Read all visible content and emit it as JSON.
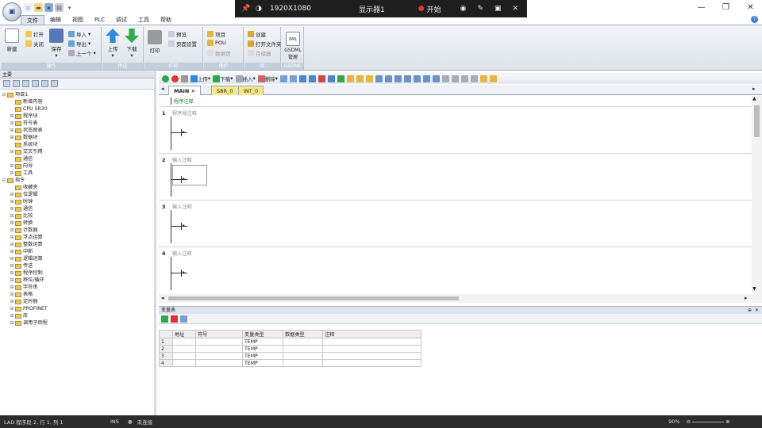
{
  "overlay": {
    "resolution": "1920X1080",
    "display": "显示器1",
    "record": "开始"
  },
  "menu": [
    "文件",
    "编辑",
    "视图",
    "PLC",
    "调试",
    "工具",
    "帮助"
  ],
  "ribbon": {
    "groups": [
      "操作",
      "传送",
      "打印",
      "保护",
      "库",
      "GSDML"
    ],
    "new": "新建",
    "open": "打开",
    "close": "关闭",
    "save": "保存",
    "import": "导入",
    "export": "导出",
    "prev": "上一个",
    "upload": "上传",
    "download": "下载",
    "print": "打印",
    "preview": "预览",
    "page_setup": "页面设置",
    "project": "项目",
    "pou": "POU",
    "data_page": "数据页",
    "create": "创建",
    "open_folder": "打开文件夹",
    "memory": "存储器",
    "gsdml": "GSDML管理"
  },
  "left_panel": {
    "title": "主要",
    "tree": [
      {
        "label": "项目1",
        "level": 0,
        "exp": "⊟"
      },
      {
        "label": "新增内容",
        "level": 1,
        "exp": ""
      },
      {
        "label": "CPU SR30",
        "level": 1,
        "exp": ""
      },
      {
        "label": "程序块",
        "level": 1,
        "exp": "⊞"
      },
      {
        "label": "符号表",
        "level": 1,
        "exp": "⊞"
      },
      {
        "label": "状态图表",
        "level": 1,
        "exp": "⊞"
      },
      {
        "label": "数据块",
        "level": 1,
        "exp": "⊞"
      },
      {
        "label": "系统块",
        "level": 1,
        "exp": ""
      },
      {
        "label": "交叉引用",
        "level": 1,
        "exp": "⊞"
      },
      {
        "label": "通信",
        "level": 1,
        "exp": ""
      },
      {
        "label": "向导",
        "level": 1,
        "exp": "⊞"
      },
      {
        "label": "工具",
        "level": 1,
        "exp": "⊞"
      },
      {
        "label": "指令",
        "level": 0,
        "exp": "⊟"
      },
      {
        "label": "收藏夹",
        "level": 1,
        "exp": ""
      },
      {
        "label": "位逻辑",
        "level": 1,
        "exp": "⊞"
      },
      {
        "label": "时钟",
        "level": 1,
        "exp": "⊞"
      },
      {
        "label": "通信",
        "level": 1,
        "exp": "⊞"
      },
      {
        "label": "比较",
        "level": 1,
        "exp": "⊞"
      },
      {
        "label": "转换",
        "level": 1,
        "exp": "⊞"
      },
      {
        "label": "计数器",
        "level": 1,
        "exp": "⊞"
      },
      {
        "label": "浮点运算",
        "level": 1,
        "exp": "⊞"
      },
      {
        "label": "整数运算",
        "level": 1,
        "exp": "⊞"
      },
      {
        "label": "中断",
        "level": 1,
        "exp": "⊞"
      },
      {
        "label": "逻辑运算",
        "level": 1,
        "exp": "⊞"
      },
      {
        "label": "传送",
        "level": 1,
        "exp": "⊞"
      },
      {
        "label": "程序控制",
        "level": 1,
        "exp": "⊞"
      },
      {
        "label": "移位/循环",
        "level": 1,
        "exp": "⊞"
      },
      {
        "label": "字符串",
        "level": 1,
        "exp": "⊞"
      },
      {
        "label": "表格",
        "level": 1,
        "exp": "⊞"
      },
      {
        "label": "定时器",
        "level": 1,
        "exp": "⊞"
      },
      {
        "label": "PROFINET",
        "level": 1,
        "exp": "⊞"
      },
      {
        "label": "库",
        "level": 1,
        "exp": "⊞"
      },
      {
        "label": "调用子例程",
        "level": 1,
        "exp": "⊞"
      }
    ]
  },
  "editor": {
    "toolbar": [
      "上传",
      "下载",
      "插入",
      "删除"
    ],
    "tabs": [
      "MAIN",
      "SBR_0",
      "INT_0"
    ],
    "block_comment": "程序注释",
    "networks": [
      {
        "num": "1",
        "comment": "程序段注释"
      },
      {
        "num": "2",
        "comment": "输入注释"
      },
      {
        "num": "3",
        "comment": "输入注释"
      },
      {
        "num": "4",
        "comment": "输入注释"
      }
    ]
  },
  "var_panel": {
    "title": "变量表",
    "headers": [
      "",
      "地址",
      "符号",
      "变量类型",
      "数据类型",
      "注释"
    ],
    "rows": [
      [
        "1",
        "",
        "",
        "TEMP",
        "",
        ""
      ],
      [
        "2",
        "",
        "",
        "TEMP",
        "",
        ""
      ],
      [
        "3",
        "",
        "",
        "TEMP",
        "",
        ""
      ],
      [
        "4",
        "",
        "",
        "TEMP",
        "",
        ""
      ]
    ]
  },
  "status": {
    "position": "LAD 程序段 2, 行 1, 列 1",
    "mode": "INS",
    "connection": "未连接",
    "zoom": "90%"
  }
}
